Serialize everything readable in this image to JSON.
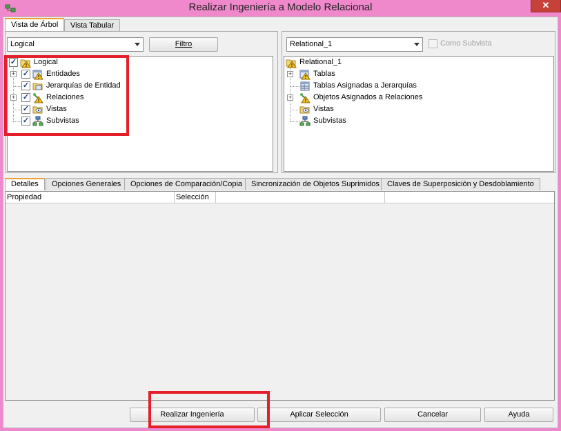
{
  "window": {
    "title": "Realizar Ingeniería a Modelo Relacional",
    "close_glyph": "✕"
  },
  "top_tabs": [
    "Vista de Árbol",
    "Vista Tabular"
  ],
  "left": {
    "select_value": "Logical",
    "filter_button": "Filtro",
    "tree": [
      {
        "label": "Logical",
        "icon": "folder-warning-icon",
        "checked": true
      },
      {
        "label": "Entidades",
        "icon": "table-warning-icon",
        "checked": true,
        "expandable": true
      },
      {
        "label": "Jerarquías de Entidad",
        "icon": "folder-icon",
        "checked": true
      },
      {
        "label": "Relaciones",
        "icon": "relation-warning-icon",
        "checked": true,
        "expandable": true
      },
      {
        "label": "Vistas",
        "icon": "view-icon",
        "checked": true
      },
      {
        "label": "Subvistas",
        "icon": "subview-icon",
        "checked": true
      }
    ]
  },
  "right": {
    "select_value": "Relational_1",
    "como_subvista": "Como Subvista",
    "tree": [
      {
        "label": "Relational_1",
        "icon": "folder-warning-icon"
      },
      {
        "label": "Tablas",
        "icon": "table-warning-icon",
        "expandable": true
      },
      {
        "label": "Tablas Asignadas a Jerarquías",
        "icon": "table-icon"
      },
      {
        "label": "Objetos Asignados a Relaciones",
        "icon": "relation-warning-icon",
        "expandable": true
      },
      {
        "label": "Vistas",
        "icon": "view-icon"
      },
      {
        "label": "Subvistas",
        "icon": "subview-icon"
      }
    ]
  },
  "bottom_tabs": [
    "Detalles",
    "Opciones Generales",
    "Opciones de Comparación/Copia",
    "Sincronización de Objetos Suprimidos",
    "Claves de Superposición y Desdoblamiento"
  ],
  "grid": {
    "columns": [
      "Propiedad",
      "Selección",
      "",
      ""
    ]
  },
  "buttons": {
    "realizar": "Realizar Ingeniería",
    "aplicar": "Aplicar Selección",
    "cancelar": "Cancelar",
    "ayuda": "Ayuda"
  },
  "colors": {
    "window_frame": "#f088cc",
    "highlight_box": "#e3202a",
    "active_tab_accent": "#f0a030"
  }
}
